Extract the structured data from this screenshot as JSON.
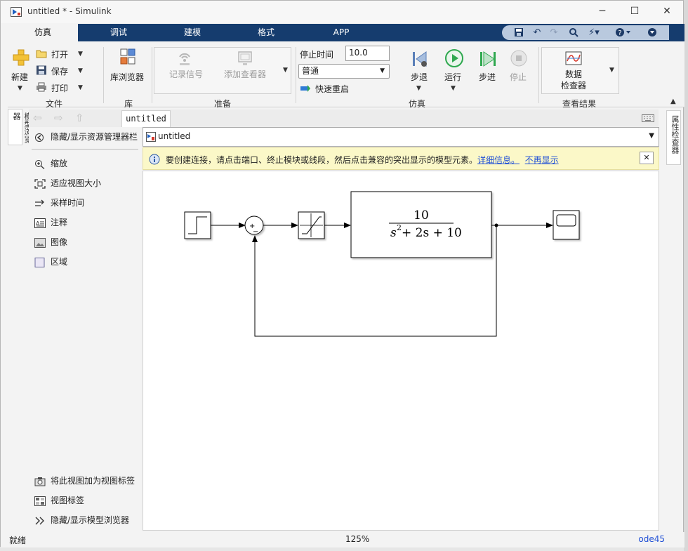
{
  "window": {
    "title": "untitled * - Simulink",
    "min_label": "─",
    "max_label": "☐",
    "close_label": "✕"
  },
  "tabs": [
    "仿真",
    "调试",
    "建模",
    "格式",
    "APP"
  ],
  "qat_icons": [
    "save-icon",
    "undo-icon",
    "redo-icon",
    "search-icon",
    "shortcut-icon",
    "help-icon",
    "collapse-icon"
  ],
  "ribbon": {
    "file": {
      "new_label": "新建",
      "open_label": "打开",
      "save_label": "保存",
      "print_label": "打印",
      "group_label": "文件"
    },
    "library": {
      "browser_label": "库浏览器",
      "group_label": "库"
    },
    "prepare": {
      "log_signals_label": "记录信号",
      "add_viewer_label": "添加查看器",
      "group_label": "准备"
    },
    "simulate": {
      "stop_time_label": "停止时间",
      "stop_time_value": "10.0",
      "mode_value": "普通",
      "fast_restart_label": "快速重启",
      "step_back_label": "步退",
      "run_label": "运行",
      "step_forward_label": "步进",
      "stop_label": "停止",
      "group_label": "仿真"
    },
    "results": {
      "inspector_line1": "数据",
      "inspector_line2": "检查器",
      "group_label": "查看结果"
    }
  },
  "side_left_label": "模型浏览器",
  "side_right_label": "属性检查器",
  "breadcrumb_tab": "untitled",
  "panel": {
    "toggle_explorer": "隐藏/显示资源管理器栏",
    "items": [
      "缩放",
      "适应视图大小",
      "采样时间",
      "注释",
      "图像",
      "区域"
    ],
    "bottom_items": [
      "将此视图加为视图标签",
      "视图标签",
      "隐藏/显示模型浏览器"
    ]
  },
  "address": {
    "model_name": "untitled"
  },
  "info_bar": {
    "message": "要创建连接，请点击端口、终止模块或线段，然后点击兼容的突出显示的模型元素。",
    "more_link": "详细信息。",
    "dismiss_link": "不再显示"
  },
  "diagram": {
    "tf_numerator": "10",
    "tf_denominator_s": "s",
    "tf_denominator_exp": "2",
    "tf_denominator_rest": " + 2s + 10",
    "sum_plus": "+",
    "sum_minus": "−"
  },
  "status": {
    "left": "就绪",
    "zoom": "125%",
    "solver": "ode45"
  },
  "colors": {
    "tab_bar": "#153c6e",
    "info_bg": "#fbf8c8",
    "link": "#1f4fd6",
    "run_green": "#2fa84f"
  }
}
